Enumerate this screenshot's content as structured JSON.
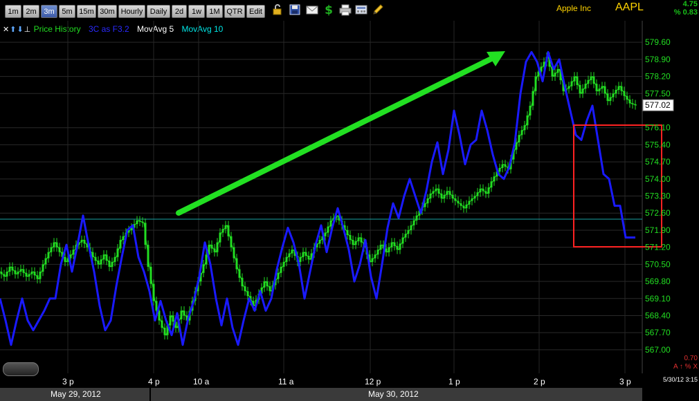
{
  "toolbar": {
    "timeframes": [
      {
        "label": "1m",
        "active": false
      },
      {
        "label": "2m",
        "active": false
      },
      {
        "label": "3m",
        "active": true
      },
      {
        "label": "5m",
        "active": false
      },
      {
        "label": "15m",
        "active": false
      },
      {
        "label": "30m",
        "active": false
      },
      {
        "label": "Hourly",
        "active": false
      },
      {
        "label": "Daily",
        "active": false
      },
      {
        "label": "2d",
        "active": false
      },
      {
        "label": "1w",
        "active": false
      },
      {
        "label": "1M",
        "active": false
      },
      {
        "label": "QTR",
        "active": false
      },
      {
        "label": "Edit",
        "active": false
      }
    ],
    "icons": [
      "lock-icon",
      "save-icon",
      "email-icon",
      "dollar-icon",
      "print-icon",
      "calculator-icon",
      "pencil-icon"
    ]
  },
  "header": {
    "company": "Apple Inc",
    "ticker": "AAPL",
    "change": "4.75",
    "change_pct": "% 0.83"
  },
  "legend": {
    "price_history": "Price History",
    "indicator": "3C as F3.2",
    "ma5": "MovAvg 5",
    "ma10": "MovAvg 10"
  },
  "colors": {
    "price_up": "#22dd22",
    "indicator": "#1a1aff",
    "ma5": "#ffffff",
    "ma10": "#00e5e5",
    "annotation_arrow": "#22e022",
    "annotation_box": "#ff2222",
    "axis_text": "#22dd22"
  },
  "footer": {
    "date_left": "May 29, 2012",
    "date_right": "May 30, 2012",
    "corner_value": "0.70",
    "corner_icons": "A ↑ % X",
    "corner_date": "5/30/12 3:15"
  },
  "chart_data": {
    "type": "line",
    "y_ticks": [
      "579.60",
      "578.90",
      "578.20",
      "577.50",
      "577.02",
      "576.10",
      "575.40",
      "574.70",
      "574.00",
      "573.30",
      "572.60",
      "571.90",
      "571.20",
      "570.50",
      "569.80",
      "569.10",
      "568.40",
      "567.70",
      "567.00"
    ],
    "last_price": "577.02",
    "ylim": [
      566.6,
      580.2
    ],
    "x_ticks": [
      "3 p",
      "4 p",
      "10 a",
      "11 a",
      "12 p",
      "1 p",
      "2 p",
      "3 p"
    ],
    "reference_line": 572.35,
    "price_path": [
      [
        0,
        570.2
      ],
      [
        8,
        570.0
      ],
      [
        16,
        570.4
      ],
      [
        24,
        570.1
      ],
      [
        32,
        570.3
      ],
      [
        40,
        570.0
      ],
      [
        48,
        570.2
      ],
      [
        56,
        569.9
      ],
      [
        64,
        570.5
      ],
      [
        72,
        571.0
      ],
      [
        80,
        571.4
      ],
      [
        88,
        571.0
      ],
      [
        96,
        570.6
      ],
      [
        104,
        570.9
      ],
      [
        112,
        571.3
      ],
      [
        120,
        571.5
      ],
      [
        128,
        571.2
      ],
      [
        136,
        570.8
      ],
      [
        144,
        570.5
      ],
      [
        152,
        570.9
      ],
      [
        160,
        570.4
      ],
      [
        168,
        570.8
      ],
      [
        176,
        571.5
      ],
      [
        184,
        571.8
      ],
      [
        192,
        572.0
      ],
      [
        200,
        572.3
      ],
      [
        208,
        572.2
      ],
      [
        216,
        570.4
      ],
      [
        224,
        569.0
      ],
      [
        232,
        568.2
      ],
      [
        240,
        567.6
      ],
      [
        248,
        568.4
      ],
      [
        256,
        567.9
      ],
      [
        264,
        568.6
      ],
      [
        272,
        568.2
      ],
      [
        280,
        569.0
      ],
      [
        288,
        569.8
      ],
      [
        296,
        570.5
      ],
      [
        304,
        571.3
      ],
      [
        312,
        571.0
      ],
      [
        320,
        571.8
      ],
      [
        328,
        572.1
      ],
      [
        336,
        571.2
      ],
      [
        344,
        570.3
      ],
      [
        352,
        569.6
      ],
      [
        360,
        569.2
      ],
      [
        368,
        568.8
      ],
      [
        376,
        569.3
      ],
      [
        384,
        569.8
      ],
      [
        392,
        569.4
      ],
      [
        400,
        569.9
      ],
      [
        408,
        570.4
      ],
      [
        416,
        570.8
      ],
      [
        424,
        571.1
      ],
      [
        432,
        570.6
      ],
      [
        440,
        571.0
      ],
      [
        448,
        570.7
      ],
      [
        456,
        571.2
      ],
      [
        464,
        571.5
      ],
      [
        472,
        571.8
      ],
      [
        480,
        572.3
      ],
      [
        488,
        572.5
      ],
      [
        496,
        572.1
      ],
      [
        504,
        571.7
      ],
      [
        512,
        571.3
      ],
      [
        520,
        571.6
      ],
      [
        528,
        571.2
      ],
      [
        536,
        570.6
      ],
      [
        544,
        570.9
      ],
      [
        552,
        571.3
      ],
      [
        560,
        571.0
      ],
      [
        568,
        571.4
      ],
      [
        576,
        571.1
      ],
      [
        584,
        571.6
      ],
      [
        592,
        571.9
      ],
      [
        600,
        572.3
      ],
      [
        608,
        572.7
      ],
      [
        616,
        573.0
      ],
      [
        624,
        573.4
      ],
      [
        632,
        573.6
      ],
      [
        640,
        573.2
      ],
      [
        648,
        573.5
      ],
      [
        656,
        573.2
      ],
      [
        664,
        573.0
      ],
      [
        672,
        572.8
      ],
      [
        680,
        573.1
      ],
      [
        688,
        573.3
      ],
      [
        696,
        573.6
      ],
      [
        704,
        573.4
      ],
      [
        712,
        573.9
      ],
      [
        720,
        574.3
      ],
      [
        728,
        574.6
      ],
      [
        736,
        574.4
      ],
      [
        744,
        575.2
      ],
      [
        752,
        575.8
      ],
      [
        760,
        576.2
      ],
      [
        768,
        577.0
      ],
      [
        776,
        578.2
      ],
      [
        784,
        578.6
      ],
      [
        792,
        579.0
      ],
      [
        800,
        578.2
      ],
      [
        808,
        578.5
      ],
      [
        816,
        577.6
      ],
      [
        824,
        577.8
      ],
      [
        832,
        578.2
      ],
      [
        840,
        577.5
      ],
      [
        848,
        577.9
      ],
      [
        856,
        578.2
      ],
      [
        864,
        577.6
      ],
      [
        872,
        577.8
      ],
      [
        880,
        577.2
      ],
      [
        888,
        577.5
      ],
      [
        896,
        577.8
      ],
      [
        904,
        577.4
      ],
      [
        912,
        577.1
      ],
      [
        920,
        577.02
      ]
    ],
    "indicator_path": [
      [
        0,
        569.1
      ],
      [
        8,
        568.2
      ],
      [
        16,
        567.2
      ],
      [
        24,
        568.2
      ],
      [
        32,
        569.1
      ],
      [
        40,
        568.2
      ],
      [
        48,
        567.8
      ],
      [
        56,
        568.2
      ],
      [
        64,
        568.6
      ],
      [
        72,
        569.1
      ],
      [
        80,
        569.1
      ],
      [
        88,
        570.5
      ],
      [
        96,
        571.3
      ],
      [
        104,
        570.2
      ],
      [
        112,
        571.3
      ],
      [
        120,
        572.5
      ],
      [
        128,
        571.3
      ],
      [
        136,
        570.2
      ],
      [
        144,
        568.8
      ],
      [
        152,
        567.8
      ],
      [
        160,
        568.2
      ],
      [
        168,
        569.6
      ],
      [
        176,
        570.8
      ],
      [
        184,
        571.9
      ],
      [
        192,
        572.1
      ],
      [
        200,
        570.8
      ],
      [
        208,
        570.2
      ],
      [
        216,
        569.4
      ],
      [
        224,
        568.2
      ],
      [
        232,
        569.0
      ],
      [
        240,
        568.2
      ],
      [
        248,
        567.6
      ],
      [
        256,
        568.5
      ],
      [
        264,
        567.2
      ],
      [
        272,
        568.3
      ],
      [
        280,
        569.0
      ],
      [
        288,
        570.0
      ],
      [
        296,
        571.4
      ],
      [
        304,
        570.5
      ],
      [
        312,
        569.1
      ],
      [
        320,
        568.0
      ],
      [
        328,
        569.1
      ],
      [
        336,
        567.9
      ],
      [
        344,
        567.2
      ],
      [
        352,
        568.2
      ],
      [
        360,
        569.1
      ],
      [
        368,
        568.6
      ],
      [
        376,
        569.4
      ],
      [
        384,
        568.6
      ],
      [
        392,
        569.1
      ],
      [
        400,
        570.3
      ],
      [
        408,
        571.2
      ],
      [
        416,
        572.0
      ],
      [
        424,
        571.4
      ],
      [
        432,
        570.5
      ],
      [
        440,
        569.1
      ],
      [
        448,
        570.2
      ],
      [
        456,
        571.3
      ],
      [
        464,
        572.1
      ],
      [
        472,
        571.0
      ],
      [
        480,
        572.0
      ],
      [
        488,
        572.8
      ],
      [
        496,
        572.0
      ],
      [
        504,
        571.1
      ],
      [
        512,
        569.8
      ],
      [
        520,
        570.5
      ],
      [
        528,
        571.5
      ],
      [
        536,
        570.0
      ],
      [
        544,
        569.1
      ],
      [
        552,
        570.5
      ],
      [
        560,
        572.0
      ],
      [
        568,
        573.0
      ],
      [
        576,
        572.4
      ],
      [
        584,
        573.3
      ],
      [
        592,
        574.0
      ],
      [
        600,
        573.3
      ],
      [
        608,
        572.6
      ],
      [
        616,
        573.5
      ],
      [
        624,
        574.7
      ],
      [
        632,
        575.5
      ],
      [
        640,
        574.2
      ],
      [
        648,
        575.2
      ],
      [
        656,
        576.8
      ],
      [
        664,
        575.8
      ],
      [
        672,
        574.6
      ],
      [
        680,
        575.4
      ],
      [
        688,
        575.6
      ],
      [
        696,
        576.8
      ],
      [
        704,
        576.0
      ],
      [
        712,
        575.0
      ],
      [
        720,
        574.2
      ],
      [
        728,
        574.0
      ],
      [
        736,
        574.5
      ],
      [
        744,
        575.5
      ],
      [
        752,
        577.5
      ],
      [
        760,
        578.8
      ],
      [
        768,
        579.2
      ],
      [
        776,
        578.8
      ],
      [
        784,
        578.0
      ],
      [
        792,
        579.2
      ],
      [
        800,
        578.5
      ],
      [
        808,
        578.9
      ],
      [
        816,
        577.8
      ],
      [
        824,
        576.8
      ],
      [
        832,
        575.8
      ],
      [
        840,
        575.6
      ],
      [
        848,
        576.4
      ],
      [
        856,
        577.0
      ],
      [
        864,
        575.6
      ],
      [
        872,
        574.2
      ],
      [
        880,
        574.0
      ],
      [
        888,
        572.9
      ],
      [
        896,
        572.9
      ],
      [
        904,
        571.6
      ],
      [
        912,
        571.6
      ],
      [
        918,
        571.6
      ]
    ]
  }
}
